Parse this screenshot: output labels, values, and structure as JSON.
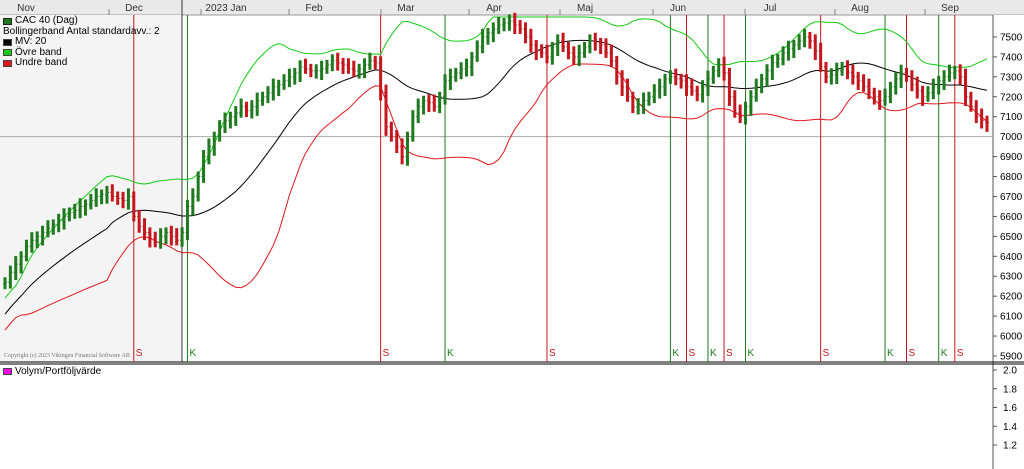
{
  "chart_data": {
    "type": "ohlc",
    "months": [
      "Nov",
      "Dec",
      "2023 Jan",
      "Feb",
      "Mar",
      "Apr",
      "Maj",
      "Jun",
      "Jul",
      "Aug",
      "Sep"
    ],
    "price_axis": {
      "ticks": [
        5900,
        6000,
        6100,
        6200,
        6300,
        6400,
        6500,
        6600,
        6700,
        6800,
        6900,
        7000,
        7100,
        7200,
        7300,
        7400,
        7500
      ],
      "range": [
        5900,
        7600
      ]
    },
    "volume_axis": {
      "ticks": [
        1.2,
        1.4,
        1.6,
        1.8,
        2.0
      ]
    },
    "legend": [
      "CAC 40 (Dag)",
      "Bollingerband  Antal standardavv.: 2",
      "MV: 20",
      "Övre band",
      "Undre band"
    ],
    "lower_legend": "Volym/Portföljvärde",
    "copyright": "Copyright (c) 2023 Vikingen Financial Software AB",
    "colors": {
      "up": "#1f7a1f",
      "down": "#c4161c",
      "mv": "#000000",
      "upper": "#12cc12",
      "lower": "#e0161c",
      "volume_swatch": "#ff00ff"
    },
    "signals": [
      {
        "label": "S",
        "index": 24
      },
      {
        "label": "K",
        "index": 34
      },
      {
        "label": "S",
        "index": 70
      },
      {
        "label": "K",
        "index": 82
      },
      {
        "label": "S",
        "index": 101
      },
      {
        "label": "K",
        "index": 124
      },
      {
        "label": "S",
        "index": 127
      },
      {
        "label": "K",
        "index": 131
      },
      {
        "label": "S",
        "index": 134
      },
      {
        "label": "K",
        "index": 138
      },
      {
        "label": "S",
        "index": 152
      },
      {
        "label": "K",
        "index": 164
      },
      {
        "label": "S",
        "index": 168
      },
      {
        "label": "K",
        "index": 174
      },
      {
        "label": "S",
        "index": 177
      }
    ],
    "close": [
      6270,
      6320,
      6360,
      6400,
      6450,
      6480,
      6500,
      6520,
      6540,
      6560,
      6580,
      6600,
      6620,
      6630,
      6650,
      6660,
      6680,
      6700,
      6710,
      6720,
      6700,
      6690,
      6680,
      6700,
      6600,
      6550,
      6520,
      6490,
      6470,
      6500,
      6520,
      6500,
      6480,
      6520,
      6650,
      6700,
      6800,
      6900,
      6950,
      7000,
      7050,
      7080,
      7100,
      7120,
      7150,
      7130,
      7150,
      7180,
      7200,
      7220,
      7250,
      7260,
      7280,
      7300,
      7320,
      7350,
      7340,
      7330,
      7330,
      7340,
      7360,
      7380,
      7370,
      7360,
      7340,
      7330,
      7340,
      7360,
      7380,
      7370,
      7220,
      7050,
      7000,
      6950,
      6900,
      7000,
      7100,
      7150,
      7180,
      7170,
      7150,
      7200,
      7280,
      7300,
      7320,
      7340,
      7350,
      7400,
      7450,
      7500,
      7520,
      7540,
      7560,
      7570,
      7580,
      7560,
      7540,
      7500,
      7460,
      7430,
      7420,
      7400,
      7450,
      7480,
      7450,
      7420,
      7400,
      7420,
      7450,
      7480,
      7470,
      7460,
      7420,
      7380,
      7300,
      7250,
      7200,
      7150,
      7160,
      7180,
      7200,
      7230,
      7250,
      7290,
      7300,
      7290,
      7280,
      7250,
      7230,
      7210,
      7250,
      7290,
      7330,
      7360,
      7320,
      7200,
      7120,
      7100,
      7150,
      7200,
      7250,
      7290,
      7330,
      7370,
      7390,
      7420,
      7440,
      7460,
      7480,
      7500,
      7480,
      7430,
      7350,
      7300,
      7310,
      7330,
      7350,
      7320,
      7300,
      7280,
      7250,
      7220,
      7200,
      7180,
      7200,
      7250,
      7290,
      7320,
      7300,
      7260,
      7230,
      7200,
      7220,
      7250,
      7280,
      7300,
      7320,
      7330,
      7300,
      7200,
      7150,
      7100,
      7080,
      7070
    ]
  }
}
